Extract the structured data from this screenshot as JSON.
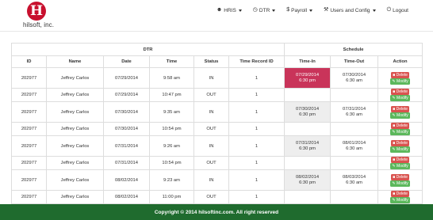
{
  "brand": {
    "logo_letter": "H",
    "name": "hilsoft, inc."
  },
  "nav": [
    {
      "label": "HRIS",
      "icon": "user-icon",
      "glyph": "☻",
      "dropdown": true
    },
    {
      "label": "DTR",
      "icon": "clock-icon",
      "glyph": "◷",
      "dropdown": true
    },
    {
      "label": "Payroll",
      "icon": "dollar-icon",
      "glyph": "$",
      "dropdown": true
    },
    {
      "label": "Users and Config",
      "icon": "wrench-icon",
      "glyph": "⚒",
      "dropdown": true
    },
    {
      "label": "Logout",
      "icon": "power-icon",
      "glyph": "⏻",
      "dropdown": false
    }
  ],
  "table": {
    "group_headers": {
      "dtr": "DTR",
      "schedule": "Schedule"
    },
    "columns": [
      "ID",
      "Name",
      "Date",
      "Time",
      "Status",
      "Time Record ID",
      "Time-In",
      "Time-Out",
      "Action"
    ],
    "delete_label": "Delete",
    "modify_label": "Modify",
    "rows": [
      {
        "id": "202977",
        "name": "Jeffrey Carlos",
        "date": "07/29/2014",
        "time": "9:58 am",
        "status": "IN",
        "record_id": "1",
        "time_in": [
          "07/29/2014",
          "6:30 pm"
        ],
        "time_out": [
          "07/30/2014",
          "6:30 am"
        ],
        "highlight": "red"
      },
      {
        "id": "202977",
        "name": "Jeffrey Carlos",
        "date": "07/29/2014",
        "time": "10:47 pm",
        "status": "OUT",
        "record_id": "1",
        "time_in": [],
        "time_out": [],
        "highlight": "none"
      },
      {
        "id": "202977",
        "name": "Jeffrey Carlos",
        "date": "07/30/2014",
        "time": "9:35 am",
        "status": "IN",
        "record_id": "1",
        "time_in": [
          "07/30/2014",
          "6:30 pm"
        ],
        "time_out": [
          "07/31/2014",
          "6:30 am"
        ],
        "highlight": "grey"
      },
      {
        "id": "202977",
        "name": "Jeffrey Carlos",
        "date": "07/30/2014",
        "time": "10:54 pm",
        "status": "OUT",
        "record_id": "1",
        "time_in": [],
        "time_out": [],
        "highlight": "none"
      },
      {
        "id": "202977",
        "name": "Jeffrey Carlos",
        "date": "07/31/2014",
        "time": "9:26 am",
        "status": "IN",
        "record_id": "1",
        "time_in": [
          "07/31/2014",
          "6:30 pm"
        ],
        "time_out": [
          "08/01/2014",
          "6:30 am"
        ],
        "highlight": "grey"
      },
      {
        "id": "202977",
        "name": "Jeffrey Carlos",
        "date": "07/31/2014",
        "time": "10:54 pm",
        "status": "OUT",
        "record_id": "1",
        "time_in": [],
        "time_out": [],
        "highlight": "none"
      },
      {
        "id": "202977",
        "name": "Jeffrey Carlos",
        "date": "08/02/2014",
        "time": "9:23 am",
        "status": "IN",
        "record_id": "1",
        "time_in": [
          "08/02/2014",
          "6:30 pm"
        ],
        "time_out": [
          "08/03/2014",
          "6:30 am"
        ],
        "highlight": "grey"
      },
      {
        "id": "202977",
        "name": "Jeffrey Carlos",
        "date": "08/02/2014",
        "time": "11:00 pm",
        "status": "OUT",
        "record_id": "1",
        "time_in": [],
        "time_out": [],
        "highlight": "none"
      }
    ]
  },
  "footer": {
    "text": "Copyright © 2014 hilsoftinc.com. All right reserved"
  },
  "colors": {
    "brand_red": "#c8102e",
    "highlight_red": "#c9345a",
    "delete": "#d9534f",
    "modify": "#5cb85c",
    "footer_green": "#1f6b2e"
  }
}
